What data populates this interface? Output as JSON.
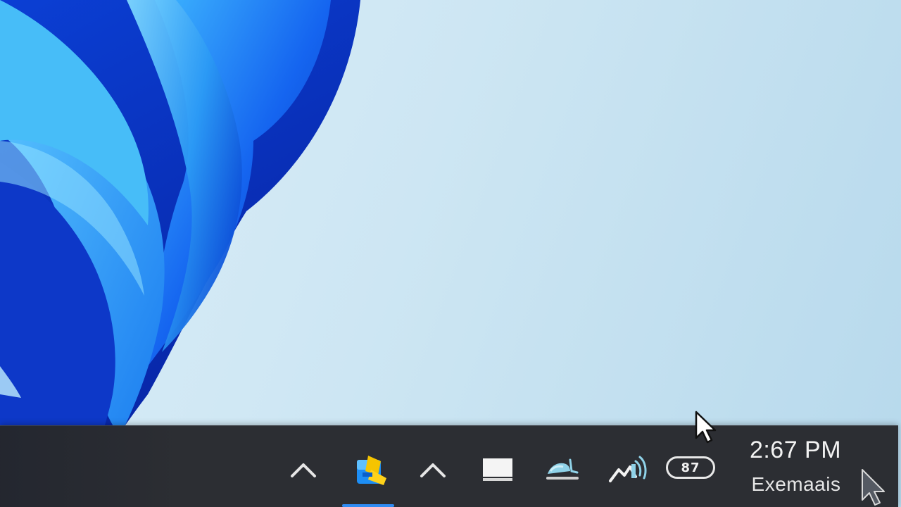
{
  "desktop": {
    "wallpaper": "windows-bloom-wallpaper",
    "accent_color": "#1a6ef0"
  },
  "taskbar": {
    "items": [
      {
        "name": "chevron-up-icon"
      },
      {
        "name": "file-explorer-icon"
      },
      {
        "name": "chevron-up-icon"
      },
      {
        "name": "display-icon"
      },
      {
        "name": "wifi-icon"
      },
      {
        "name": "sound-icon"
      }
    ],
    "battery_label": "87",
    "active_indicator_color": "#2f8bf2"
  },
  "clock": {
    "time": "2:67 PM",
    "date": "Exemaais"
  }
}
